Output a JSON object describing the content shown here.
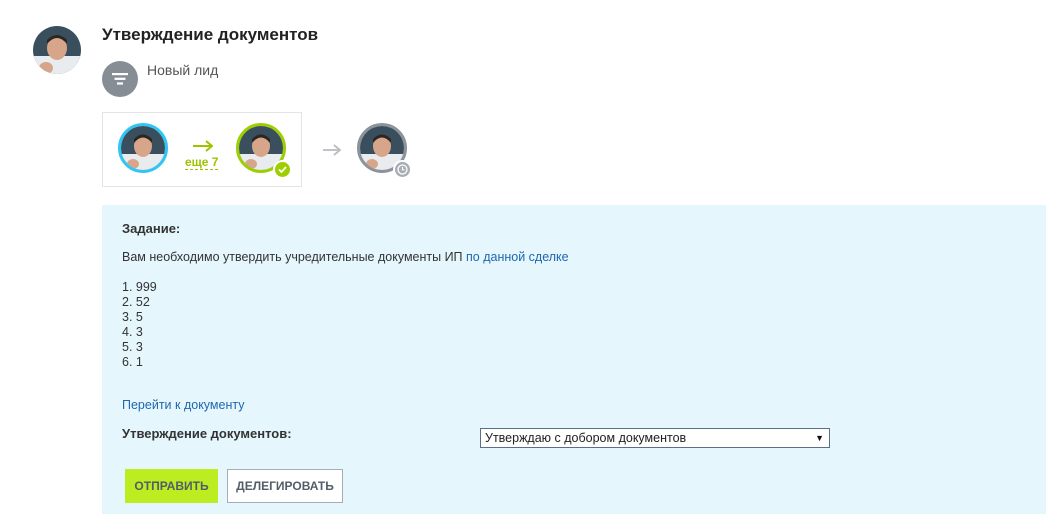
{
  "task": {
    "title": "Утверждение документов",
    "stage_label": "Новый лид"
  },
  "flow": {
    "more_link": "еще 7"
  },
  "panel": {
    "task_label": "Задание:",
    "description_prefix": "Вам необходимо утвердить учредительные документы ИП ",
    "description_link": "по данной сделке",
    "list": [
      "1. 999",
      "2. 52",
      "3. 5",
      "4. 3",
      "5. 3",
      "6. 1"
    ],
    "document_link": "Перейти к документу",
    "field_label": "Утверждение документов:",
    "select_value": "Утверждаю с добором документов"
  },
  "buttons": {
    "send": "Отправить",
    "delegate": "Делегировать"
  },
  "colors": {
    "panel_bg": "#e5f6fd",
    "send_button": "#bbed21",
    "ring_author": "#2fc6f6",
    "ring_done": "#9dcf00",
    "ring_pending": "#8c939a",
    "link": "#2067b0"
  },
  "icons": {
    "stage": "filter-icon",
    "done_badge": "check-icon",
    "pending_badge": "clock-icon",
    "flow_arrow": "arrow-right-icon"
  }
}
